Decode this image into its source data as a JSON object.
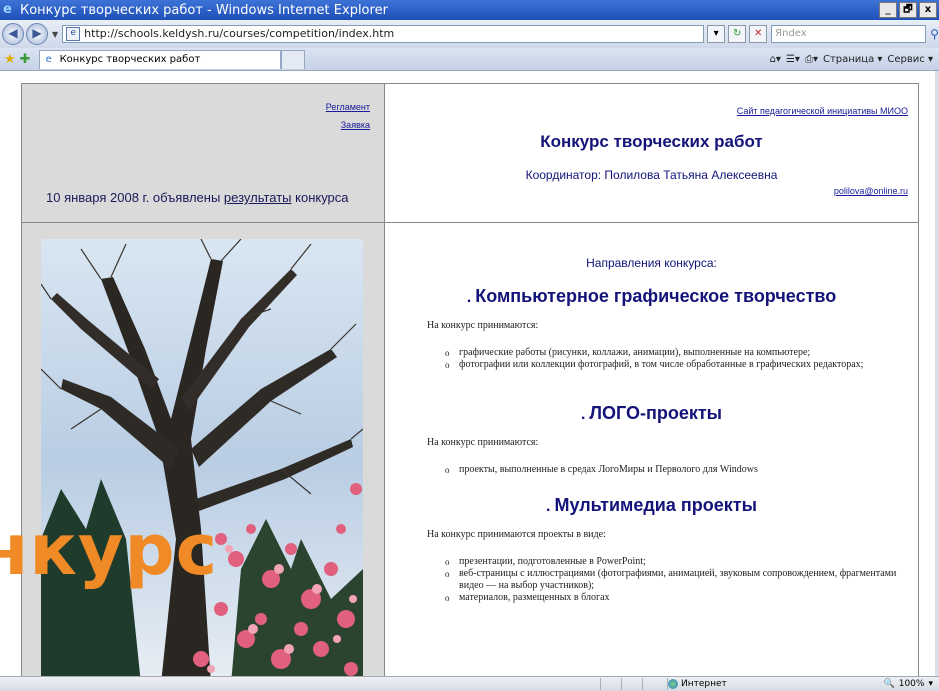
{
  "window": {
    "title": "Конкурс творческих работ - Windows Internet Explorer",
    "controls": [
      "_",
      "🗗",
      "x"
    ]
  },
  "addressbar": {
    "url": "http://schools.keldysh.ru/courses/competition/index.htm",
    "search_placeholder": "Яndex"
  },
  "tabs": {
    "active_label": "Конкурс творческих работ",
    "commands": [
      "Страница ▾",
      "Сервис ▾"
    ]
  },
  "page": {
    "left_links": [
      "Регламент",
      "Заявка"
    ],
    "announce_prefix": "10 января 2008 г. объявлены ",
    "announce_link": "результаты",
    "announce_suffix": " конкурса",
    "site_link": "Сайт педагогической инициативы МИОО",
    "title": "Конкурс творческих работ",
    "coordinator": "Координатор: Полилова Татьяна Алексеевна",
    "email": "polilova@online.ru",
    "directions_heading": "Направления конкурса:",
    "sections": [
      {
        "title": "Компьютерное графическое творчество",
        "intro": "На конкурс принимаются:",
        "items": [
          "графические работы (рисунки, коллажи, анимации), выполненные на компьютере;",
          "фотографии или коллекции фотографий, в том числе обработанные в графических редакторах;"
        ]
      },
      {
        "title": "ЛОГО-проекты",
        "intro": "На конкурс принимаются:",
        "items": [
          "проекты, выполненные в средах ЛогоМиры и Перволого для Windows"
        ]
      },
      {
        "title": "Мультимедиа проекты",
        "intro": "На конкурс принимаются проекты в виде:",
        "items": [
          "презентации, подготовленные в PowerPoint;",
          "веб-страницы с иллюстрациями (фотографиями, анимацией, звуковым сопровождением, фрагментами видео — на выбор участников);",
          "материалов, размещенных в блогах"
        ]
      }
    ]
  },
  "overlay": {
    "text": "нкурс",
    "color": "#f08a26"
  },
  "statusbar": {
    "zone": "Интернет",
    "zoom": "100%"
  }
}
